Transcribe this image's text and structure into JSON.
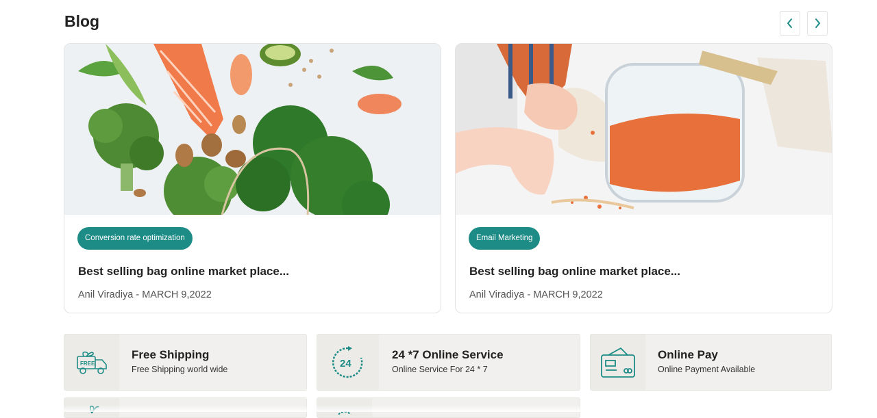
{
  "section": {
    "title": "Blog"
  },
  "nav": {
    "prev_icon": "chevron-left-icon",
    "next_icon": "chevron-right-icon"
  },
  "posts": [
    {
      "tag": "Conversion rate optimization",
      "title": "Best selling bag online market place...",
      "meta": "Anil Viradiya - MARCH 9,2022",
      "image": "healthy-food-image"
    },
    {
      "tag": "Email Marketing",
      "title": "Best selling bag online market place...",
      "meta": "Anil Viradiya - MARCH 9,2022",
      "image": "lentils-jar-image"
    }
  ],
  "features": [
    {
      "title": "Free Shipping",
      "subtitle": "Free Shipping world wide",
      "icon": "free-delivery-truck-icon"
    },
    {
      "title": "24 *7 Online Service",
      "subtitle": "Online Service For 24 * 7",
      "icon": "24-hour-service-icon"
    },
    {
      "title": "Online Pay",
      "subtitle": "Online Payment Available",
      "icon": "credit-card-icon"
    }
  ],
  "colors": {
    "accent": "#1e8c86",
    "feature_bg": "#f1f0ee",
    "text": "#222222"
  }
}
